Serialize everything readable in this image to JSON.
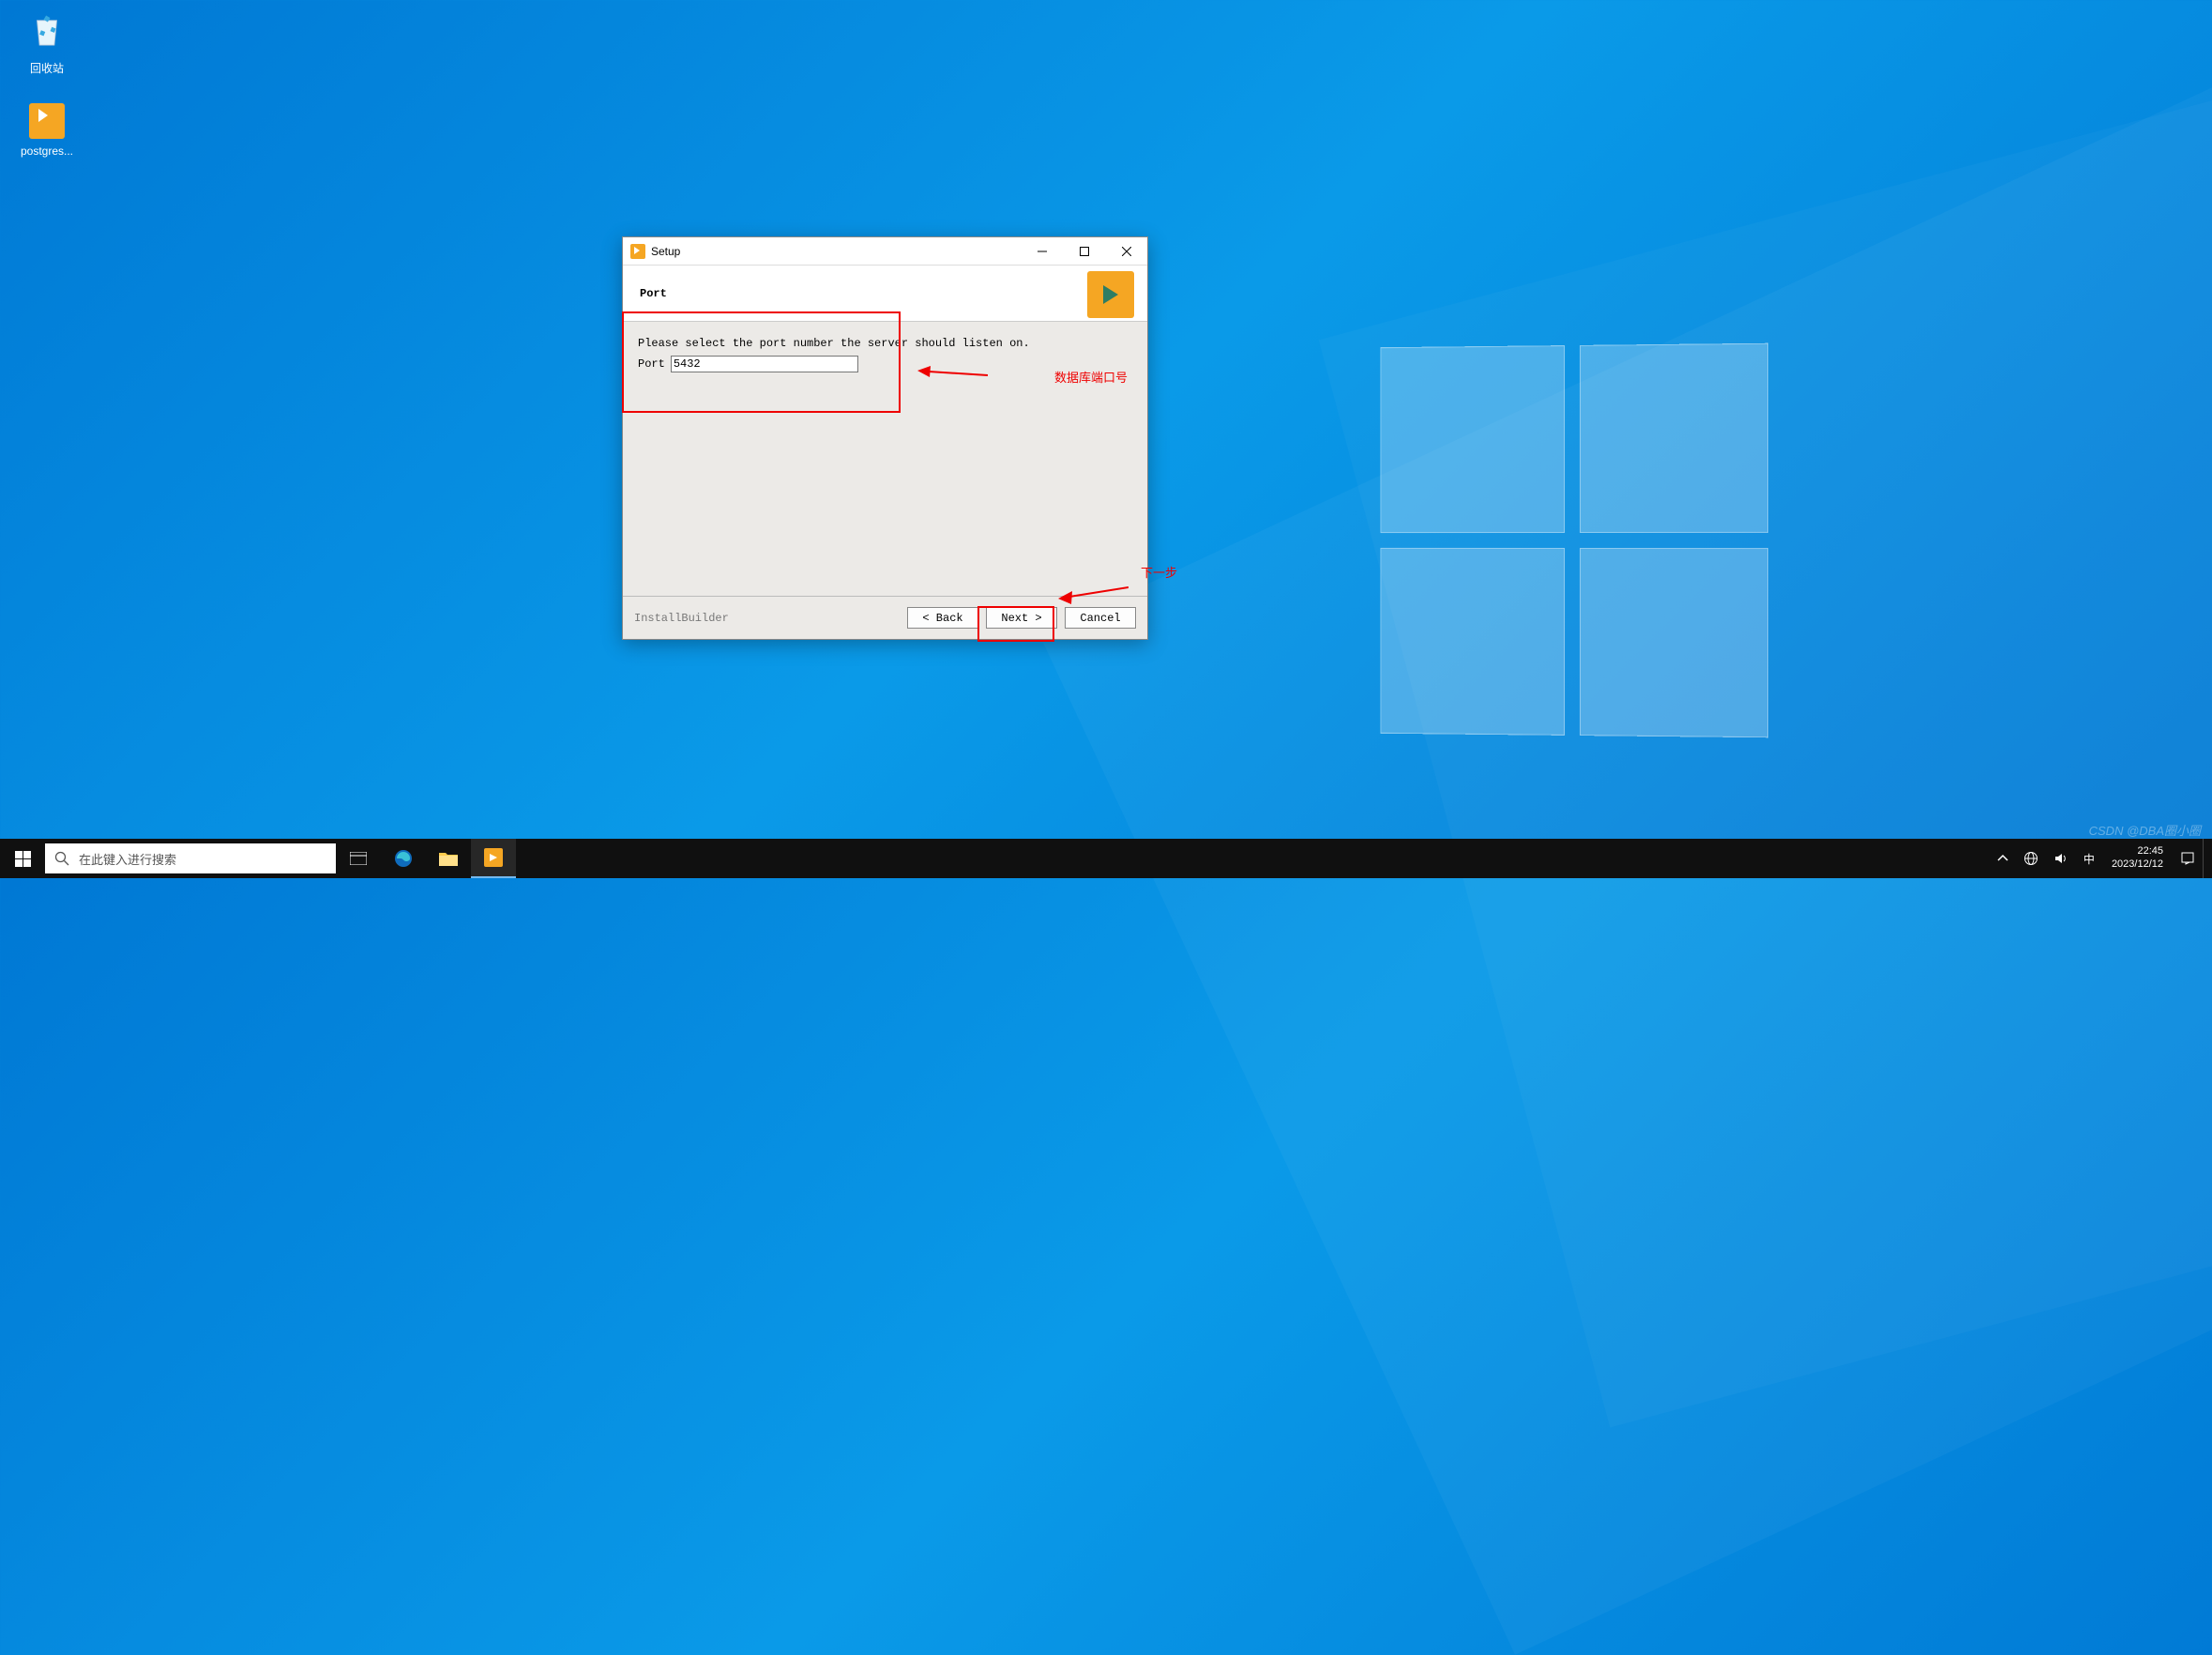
{
  "desktop": {
    "recycle_label": "回收站",
    "postgres_label": "postgres..."
  },
  "dialog": {
    "title": "Setup",
    "heading": "Port",
    "instruction": "Please select the port number the server should listen on.",
    "port_label": "Port",
    "port_value": "5432",
    "builder": "InstallBuilder",
    "back": "< Back",
    "next": "Next >",
    "cancel": "Cancel"
  },
  "annotations": {
    "port": "数据库端口号",
    "next": "下一步"
  },
  "taskbar": {
    "search_placeholder": "在此键入进行搜索",
    "time": "22:45",
    "date": "2023/12/12"
  },
  "watermark": "CSDN @DBA圈小圈"
}
